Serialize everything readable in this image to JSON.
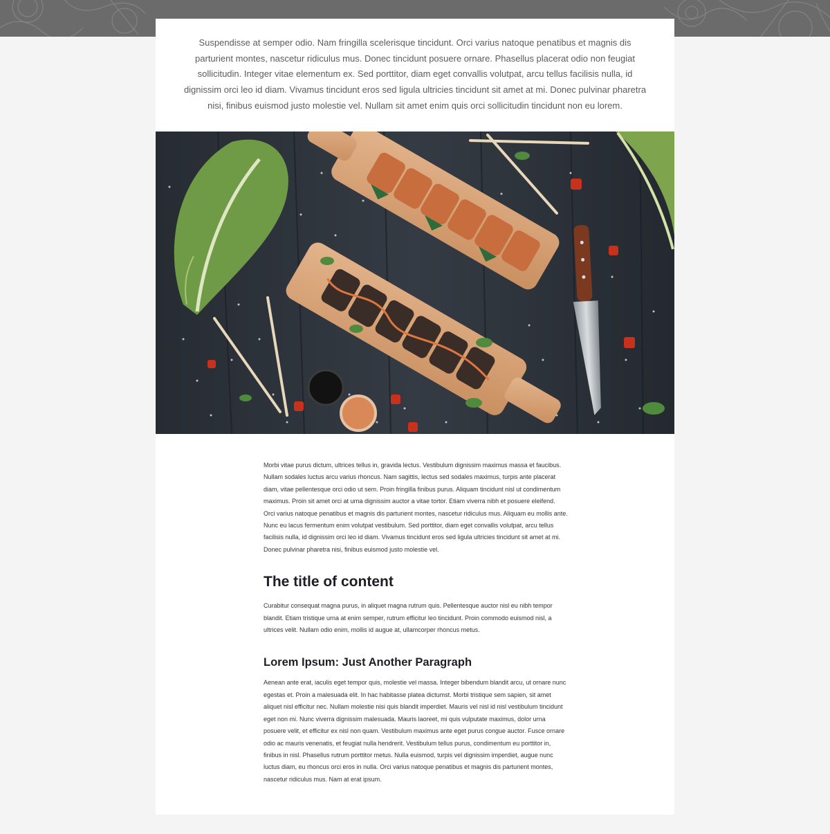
{
  "banner": {
    "color": "#6b6b6b"
  },
  "intro": {
    "text": "Suspendisse at semper odio. Nam fringilla scelerisque tincidunt. Orci varius natoque penatibus et magnis dis parturient montes, nascetur ridiculus mus. Donec tincidunt posuere ornare. Phasellus placerat odio non feugiat sollicitudin. Integer vitae elementum ex. Sed porttitor, diam eget convallis volutpat, arcu tellus facilisis nulla, id dignissim orci leo id diam. Vivamus tincidunt eros sed ligula ultricies tincidunt sit amet at mi. Donec pulvinar pharetra nisi, finibus euismod justo molestie vel. Nullam sit amet enim quis orci sollicitudin tincidunt non eu lorem."
  },
  "hero_image": {
    "subject": "sushi rolls on wooden boards with lettuce, chopsticks, knife and sauces on dark wood table"
  },
  "article": {
    "paragraph_1": "Morbi vitae purus dictum, ultrices tellus in, gravida lectus. Vestibulum dignissim maximus massa et faucibus. Nullam sodales luctus arcu varius rhoncus. Nam sagittis, lectus sed sodales maximus, turpis ante placerat diam, vitae pellentesque orci odio ut sem. Proin fringilla finibus purus. Aliquam tincidunt nisl ut condimentum maximus. Proin sit amet orci at urna dignissim auctor a vitae tortor. Etiam viverra nibh et posuere eleifend. Orci varius natoque penatibus et magnis dis parturient montes, nascetur ridiculus mus. Aliquam eu mollis ante. Nunc eu lacus fermentum enim volutpat vestibulum. Sed porttitor, diam eget convallis volutpat, arcu tellus facilisis nulla, id dignissim orci leo id diam. Vivamus tincidunt eros sed ligula ultricies tincidunt sit amet at mi. Donec pulvinar pharetra nisi, finibus euismod justo molestie vel.",
    "heading_1": "The title of content",
    "paragraph_2": "Curabitur consequat magna purus, in aliquet magna rutrum quis. Pellentesque auctor nisl eu nibh tempor blandit. Etiam tristique urna at enim semper, rutrum efficitur leo tincidunt. Proin commodo euismod nisl, a ultrices velit. Nullam odio enim, mollis id augue at, ullamcorper rhoncus metus.",
    "heading_2": "Lorem Ipsum: Just Another Paragraph",
    "paragraph_3": "Aenean ante erat, iaculis eget tempor quis, molestie vel massa. Integer bibendum blandit arcu, ut ornare nunc egestas et. Proin a malesuada elit. In hac habitasse platea dictumst. Morbi tristique sem sapien, sit amet aliquet nisl efficitur nec. Nullam molestie nisi quis blandit imperdiet. Mauris vel nisl id nisl vestibulum tincidunt eget non mi. Nunc viverra dignissim malesuada. Mauris laoreet, mi quis vulputate maximus, dolor urna posuere velit, et efficitur ex nisl non quam. Vestibulum maximus ante eget purus congue auctor. Fusce ornare odio ac mauris venenatis, et feugiat nulla hendrerit. Vestibulum tellus purus, condimentum eu porttitor in, finibus in nisl. Phasellus rutrum porttitor metus. Nulla euismod, turpis vel dignissim imperdiet, augue nunc luctus diam, eu rhoncus orci eros in nulla. Orci varius natoque penatibus et magnis dis parturient montes, nascetur ridiculus mus. Nam at erat ipsum."
  }
}
